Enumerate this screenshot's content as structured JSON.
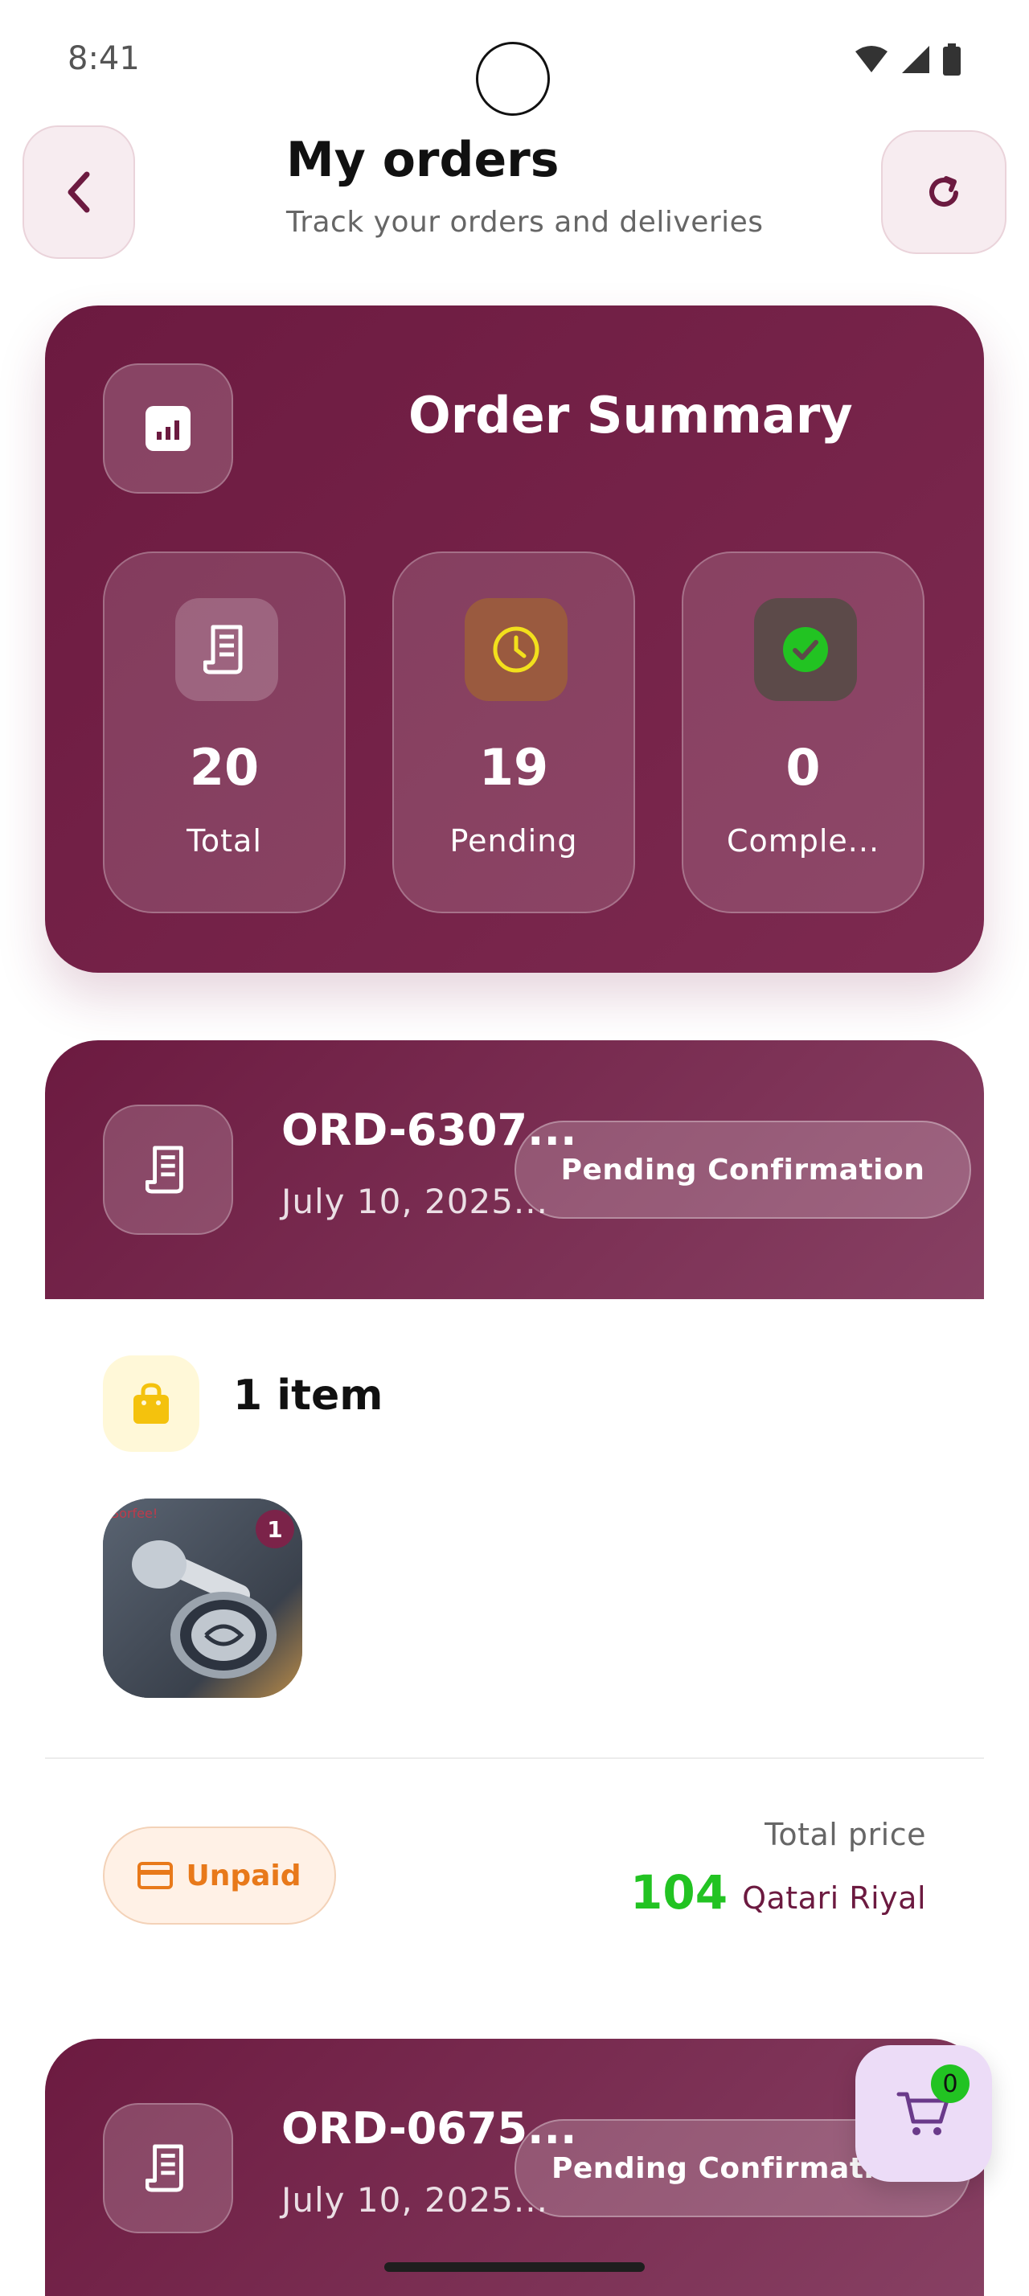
{
  "status_bar": {
    "time": "8:41"
  },
  "header": {
    "title": "My orders",
    "subtitle": "Track your orders and deliveries",
    "back_icon": "chevron-left-icon",
    "refresh_icon": "refresh-icon"
  },
  "summary": {
    "title": "Order Summary",
    "icon": "bar-chart-icon",
    "stats": [
      {
        "value": "20",
        "label": "Total",
        "icon": "receipt-icon",
        "icon_bg": "#ffffff33"
      },
      {
        "value": "19",
        "label": "Pending",
        "icon": "clock-icon",
        "icon_bg": "#9a5a3f"
      },
      {
        "value": "0",
        "label": "Comple...",
        "icon": "check-circle-icon",
        "icon_bg": "#5c4a49"
      }
    ]
  },
  "orders": [
    {
      "id": "ORD-6307...",
      "date": "July 10, 2025...",
      "status": "Pending Confirmation",
      "items_label": "1 item",
      "product_badge": "1",
      "product_watermark": "Sorfee!",
      "payment_status": "Unpaid",
      "total_label": "Total price",
      "total_amount": "104",
      "currency": "Qatari Riyal"
    },
    {
      "id": "ORD-0675...",
      "date": "July 10, 2025...",
      "status": "Pending Confirmatio"
    }
  ],
  "cart": {
    "count": "0",
    "icon": "cart-icon"
  },
  "colors": {
    "brand": "#6c1a40",
    "pending_icon": "#f2e01c",
    "completed_icon": "#22c322",
    "unpaid": "#e8791a",
    "price": "#22c322"
  }
}
